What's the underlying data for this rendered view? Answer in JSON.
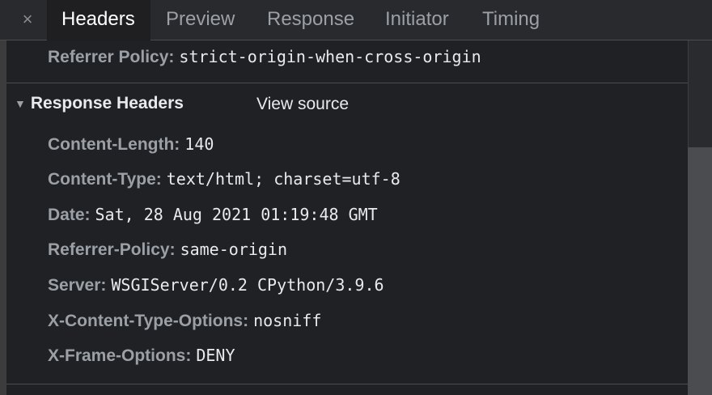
{
  "tabs": [
    {
      "label": "Headers",
      "active": true
    },
    {
      "label": "Preview",
      "active": false
    },
    {
      "label": "Response",
      "active": false
    },
    {
      "label": "Initiator",
      "active": false
    },
    {
      "label": "Timing",
      "active": false
    }
  ],
  "close_glyph": "×",
  "referrer_row": {
    "name": "Referrer Policy:",
    "value": "strict-origin-when-cross-origin"
  },
  "response_section": {
    "title": "Response Headers",
    "view_source": "View source",
    "expanded": true
  },
  "response_headers": [
    {
      "name": "Content-Length:",
      "value": "140"
    },
    {
      "name": "Content-Type:",
      "value": "text/html; charset=utf-8"
    },
    {
      "name": "Date:",
      "value": "Sat, 28 Aug 2021 01:19:48 GMT"
    },
    {
      "name": "Referrer-Policy:",
      "value": "same-origin"
    },
    {
      "name": "Server:",
      "value": "WSGIServer/0.2 CPython/3.9.6"
    },
    {
      "name": "X-Content-Type-Options:",
      "value": "nosniff"
    },
    {
      "name": "X-Frame-Options:",
      "value": "DENY"
    }
  ],
  "colors": {
    "background": "#202124",
    "header_name": "#9aa0a6",
    "header_value": "#e8eaed",
    "tab_active": "#ffffff",
    "tab_inactive": "#9aa0a6"
  }
}
